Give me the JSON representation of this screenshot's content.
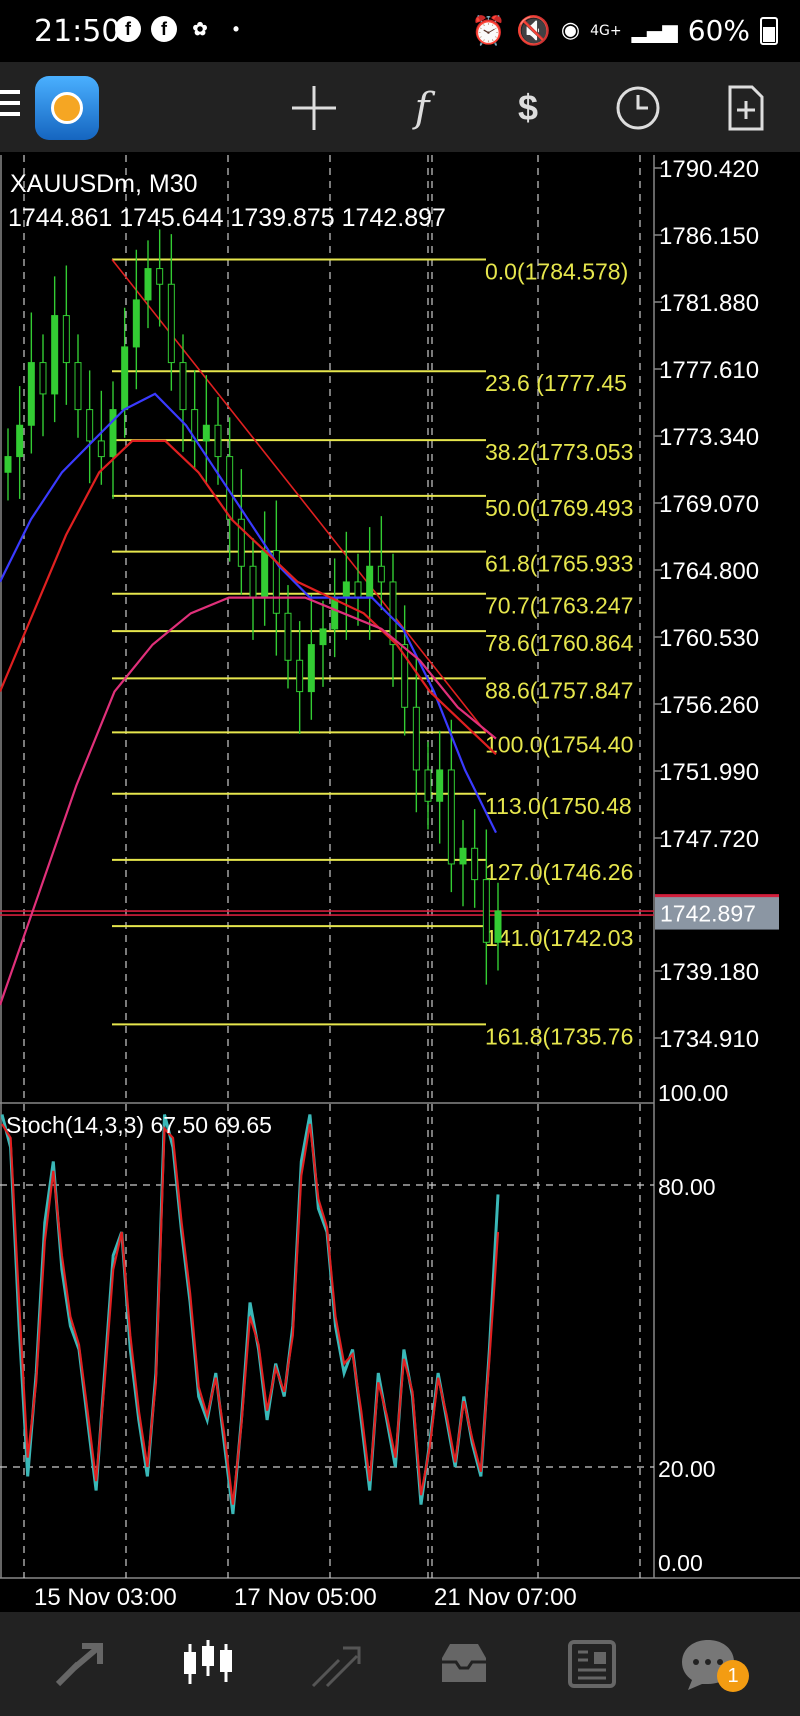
{
  "status": {
    "time": "21:50",
    "battery": "60%",
    "network": "4G+"
  },
  "toolbar": {
    "icons": [
      "menu-icon",
      "metatrader-logo",
      "crosshair-icon",
      "indicators-icon",
      "symbols-icon",
      "timeframe-icon",
      "new-order-icon"
    ]
  },
  "header": {
    "symbol_line": "XAUUSDm, M30",
    "ohlc_line": "1744.861 1745.644 1739.875 1742.897"
  },
  "price_axis": [
    "1790.420",
    "1786.150",
    "1781.880",
    "1777.610",
    "1773.340",
    "1769.070",
    "1764.800",
    "1760.530",
    "1756.260",
    "1751.990",
    "1747.720",
    "1739.180",
    "1734.910"
  ],
  "current_price_label": "1742.897",
  "fib_labels": [
    "0.0(1784.578)",
    "23.6 (1777.45",
    "38.2(1773.053",
    "50.0(1769.493",
    "61.8(1765.933",
    "70.7(1763.247",
    "78.6(1760.864",
    "88.6(1757.847",
    "100.0(1754.40",
    "113.0(1750.48",
    "127.0(1746.26",
    "141.0(1742.03",
    "161.8(1735.76"
  ],
  "stoch": {
    "label": "Stoch(14,3,3) 67.50 69.65",
    "axis": [
      "100.00",
      "80.00",
      "20.00",
      "0.00"
    ]
  },
  "time_axis": [
    "15 Nov 03:00",
    "17 Nov 05:00",
    "21 Nov 07:00"
  ],
  "colors": {
    "candle_up": "#33cc33",
    "candle_down": "#33cc33",
    "fib": "#e6e64d",
    "ma_fast": "#3a3aff",
    "ma_mid": "#e02020",
    "ma_slow": "#e0307a",
    "stoch_main": "#3ab8b8",
    "stoch_signal": "#e02020",
    "price_line": "#d21f3c"
  },
  "chart_data": [
    {
      "type": "candlestick",
      "title": "XAUUSDm, M30",
      "ylim": [
        1731.0,
        1792.0
      ],
      "x_ticks": [
        "15 Nov 03:00",
        "17 Nov 05:00",
        "21 Nov 07:00"
      ],
      "current_price": 1742.897,
      "last_bar": {
        "open": 1744.861,
        "high": 1745.644,
        "low": 1739.875,
        "close": 1742.897
      },
      "close_approx": [
        1772,
        1774,
        1778,
        1776,
        1781,
        1778,
        1775,
        1773,
        1772,
        1775,
        1779,
        1782,
        1784,
        1783,
        1778,
        1775,
        1773,
        1774,
        1772,
        1768,
        1765,
        1763,
        1766,
        1762,
        1759,
        1757,
        1760,
        1761,
        1763,
        1764,
        1763,
        1765,
        1764,
        1760,
        1756,
        1752,
        1750,
        1752,
        1746,
        1747,
        1745,
        1741,
        1743
      ],
      "fibonacci": [
        {
          "level": 0.0,
          "price": 1784.578
        },
        {
          "level": 23.6,
          "price": 1777.45
        },
        {
          "level": 38.2,
          "price": 1773.053
        },
        {
          "level": 50.0,
          "price": 1769.493
        },
        {
          "level": 61.8,
          "price": 1765.933
        },
        {
          "level": 70.7,
          "price": 1763.247
        },
        {
          "level": 78.6,
          "price": 1760.864
        },
        {
          "level": 88.6,
          "price": 1757.847
        },
        {
          "level": 100.0,
          "price": 1754.4
        },
        {
          "level": 113.0,
          "price": 1750.48
        },
        {
          "level": 127.0,
          "price": 1746.26
        },
        {
          "level": 141.0,
          "price": 1742.03
        },
        {
          "level": 161.8,
          "price": 1735.76
        }
      ],
      "series": [
        {
          "values": [
            1764,
            1768,
            1771,
            1773,
            1775,
            1776,
            1774,
            1771,
            1768,
            1765,
            1763,
            1763,
            1763,
            1761,
            1757,
            1752,
            1748
          ]
        },
        {
          "values": [
            1757,
            1762,
            1767,
            1771,
            1773,
            1773,
            1771,
            1768,
            1766,
            1764,
            1763,
            1762,
            1760,
            1757,
            1755,
            1753
          ]
        },
        {
          "values": [
            1737,
            1744,
            1751,
            1757,
            1760,
            1762,
            1763,
            1763,
            1763,
            1762,
            1761,
            1759,
            1756,
            1754
          ]
        }
      ]
    },
    {
      "type": "line",
      "title": "Stoch(14,3,3) 67.50 69.65",
      "ylim": [
        0,
        100
      ],
      "x_ticks": [
        "15 Nov 03:00",
        "17 Nov 05:00",
        "21 Nov 07:00"
      ],
      "levels": [
        80,
        20
      ],
      "series": [
        {
          "values": [
            95,
            88,
            50,
            18,
            40,
            72,
            85,
            62,
            50,
            45,
            30,
            15,
            40,
            65,
            70,
            45,
            30,
            18,
            40,
            95,
            88,
            70,
            55,
            35,
            30,
            40,
            25,
            10,
            30,
            55,
            45,
            30,
            42,
            35,
            50,
            85,
            95,
            75,
            70,
            50,
            40,
            45,
            30,
            15,
            40,
            30,
            20,
            45,
            35,
            12,
            25,
            40,
            30,
            20,
            35,
            25,
            18,
            45,
            78
          ]
        },
        {
          "values": [
            93,
            90,
            55,
            22,
            38,
            68,
            83,
            65,
            52,
            46,
            32,
            17,
            38,
            62,
            70,
            48,
            32,
            20,
            38,
            92,
            90,
            72,
            57,
            37,
            31,
            39,
            27,
            12,
            29,
            52,
            46,
            32,
            41,
            36,
            48,
            82,
            93,
            77,
            71,
            52,
            42,
            44,
            32,
            17,
            38,
            31,
            22,
            43,
            36,
            14,
            24,
            39,
            31,
            21,
            34,
            26,
            19,
            43,
            70
          ]
        }
      ]
    }
  ]
}
